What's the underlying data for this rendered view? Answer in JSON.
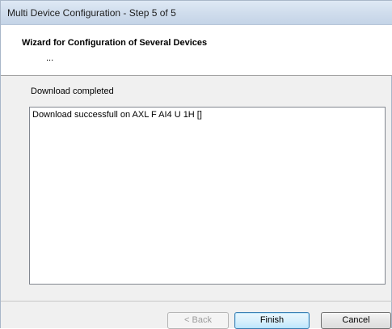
{
  "window": {
    "title": "Multi Device Configuration - Step 5 of 5"
  },
  "header": {
    "heading": "Wizard for Configuration of Several Devices",
    "subheading": "..."
  },
  "main": {
    "status_label": "Download completed",
    "log_lines": [
      "Download successfull on AXL F AI4 U 1H []"
    ]
  },
  "footer": {
    "back_label": "< Back",
    "finish_label": "Finish",
    "cancel_label": "Cancel"
  }
}
